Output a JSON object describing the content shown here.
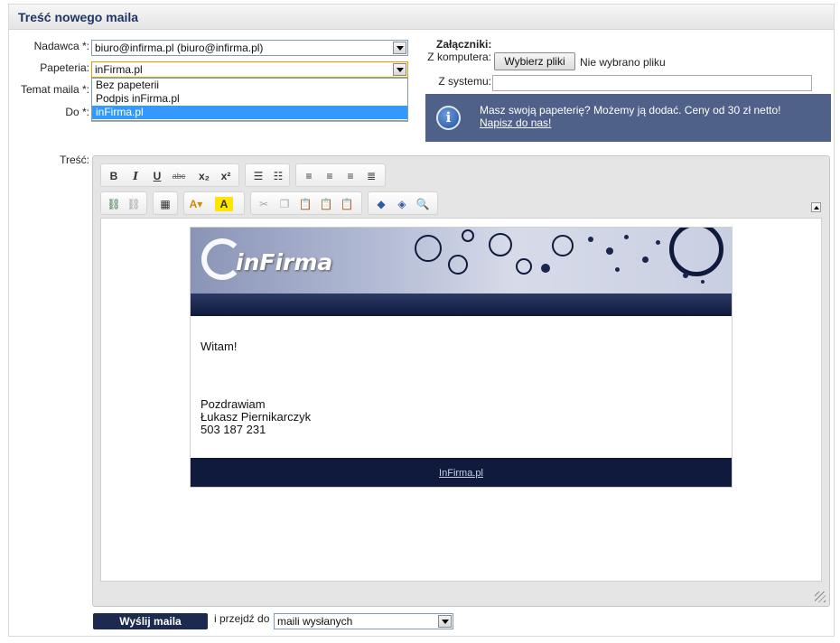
{
  "panel": {
    "title": "Treść nowego maila"
  },
  "form": {
    "sender": {
      "label": "Nadawca *:",
      "value": "biuro@infirma.pl (biuro@infirma.pl)"
    },
    "stationery": {
      "label": "Papeteria:",
      "value": "inFirma.pl",
      "options": [
        "Bez papeterii",
        "Podpis inFirma.pl",
        "inFirma.pl"
      ],
      "selected_index": 2
    },
    "subject": {
      "label": "Temat maila *:"
    },
    "to": {
      "label": "Do *:"
    },
    "content_label": "Treść:"
  },
  "attachments": {
    "title": "Załączniki:",
    "from_computer_label": "Z komputera:",
    "choose_button": "Wybierz pliki",
    "no_file_text": "Nie wybrano pliku",
    "from_system_label": "Z systemu:"
  },
  "info": {
    "text": "Masz swoją papeterię? Możemy ją dodać. Ceny od 30 zł netto!",
    "link": "Napisz do nas!"
  },
  "toolbar": {
    "bold": "B",
    "italic": "I",
    "underline": "U",
    "strike": "abc",
    "subscript": "x₂",
    "superscript": "x²"
  },
  "letter": {
    "logo": "inFirma",
    "greeting": "Witam!",
    "closing": "Pozdrawiam",
    "name": "Łukasz Piernikarczyk",
    "phone": "503 187 231",
    "footer_link": "InFirma.pl"
  },
  "actions": {
    "send_button": "Wyślij maila",
    "then_go_label": "i przejdź do",
    "destination": "maili wysłanych"
  },
  "colors": {
    "title": "#1f3562",
    "info_bg": "#4f6089",
    "dark_navy": "#0f1a3c",
    "selection": "#3399ff"
  }
}
